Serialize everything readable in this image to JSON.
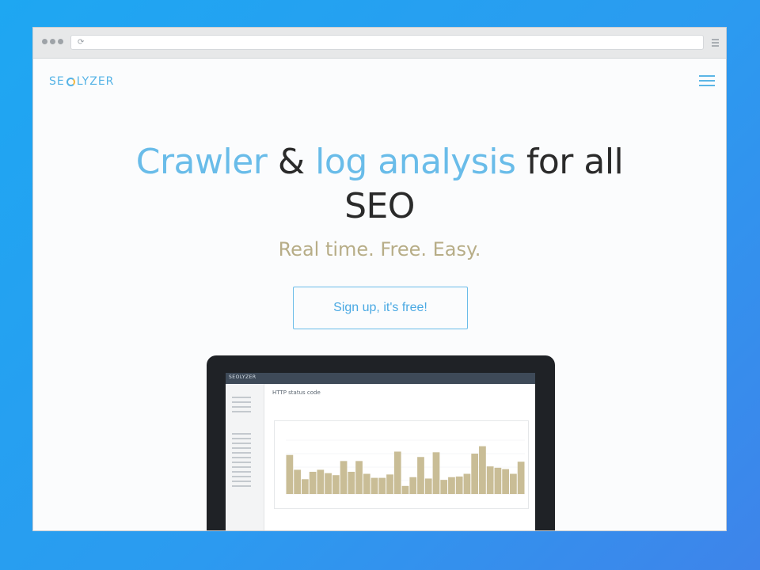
{
  "browser": {
    "dots": 3
  },
  "nav": {
    "logo_left": "SE",
    "logo_right": "LYZER",
    "menu_icon": "hamburger-icon"
  },
  "hero": {
    "title_part1": "Crawler",
    "title_amp": " & ",
    "title_part2": "log analysis",
    "title_part3": " for all",
    "title_line2": "SEO",
    "tagline": "Real time. Free. Easy.",
    "cta_label": "Sign up, it's free!"
  },
  "app_preview": {
    "app_logo": "SEOLYZER",
    "page_title": "HTTP status code",
    "chart_data": {
      "type": "bar",
      "values": [
        58,
        36,
        22,
        33,
        36,
        31,
        28,
        49,
        33,
        49,
        30,
        24,
        24,
        29,
        63,
        12,
        25,
        55,
        23,
        62,
        21,
        25,
        26,
        30,
        60,
        71,
        41,
        39,
        37,
        30,
        48
      ]
    }
  },
  "colors": {
    "accent_blue": "#69bce9",
    "tagline_gold": "#b7ad87",
    "bar_fill": "#c9bd96"
  }
}
